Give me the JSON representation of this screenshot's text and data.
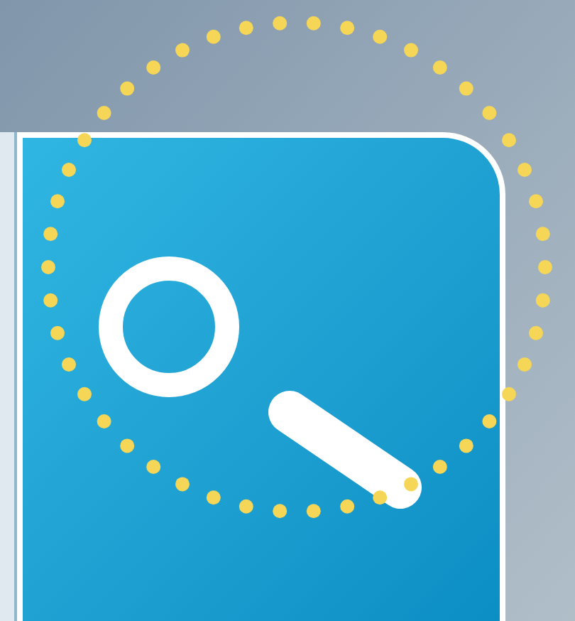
{
  "search_button": {
    "highlighted": true
  }
}
